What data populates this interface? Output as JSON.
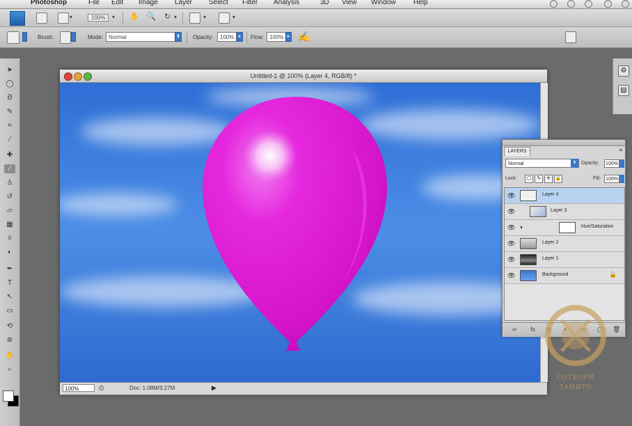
{
  "menu": {
    "app": "Photoshop",
    "items": [
      "File",
      "Edit",
      "Image",
      "Layer",
      "Select",
      "Filter",
      "Analysis",
      "3D",
      "View",
      "Window",
      "Help"
    ]
  },
  "appbar": {
    "zoom": "100%"
  },
  "options": {
    "brush_label": "Brush:",
    "mode_label": "Mode:",
    "mode_value": "Normal",
    "opacity_label": "Opacity:",
    "opacity_value": "100%",
    "flow_label": "Flow:",
    "flow_value": "100%"
  },
  "document": {
    "title": "Untitled-1 @ 100% (Layer 4, RGB/8) *",
    "zoom": "100%",
    "doc_info": "Doc: 1.08M/3.27M"
  },
  "layers_panel": {
    "tab": "LAYERS",
    "blend_mode": "Normal",
    "opacity_label": "Opacity:",
    "opacity_value": "100%",
    "fill_label": "Fill:",
    "fill_value": "100%",
    "lock_label": "Lock:",
    "layers": [
      {
        "name": "Layer 4",
        "selected": true
      },
      {
        "name": "Layer 3",
        "selected": false
      },
      {
        "name": "Hue/Saturation",
        "selected": false
      },
      {
        "name": "Layer 2",
        "selected": false
      },
      {
        "name": "Layer 1",
        "selected": false
      },
      {
        "name": "Background",
        "selected": false
      }
    ]
  },
  "watermark": {
    "line1": "СОТВОРИ",
    "line2": "ЗАНЯТО"
  },
  "colors": {
    "balloon": "#e21ad6",
    "sky": "#3a78d8",
    "selection": "#b7d3f0",
    "accent": "#3b78c9"
  },
  "icons": {
    "tools": [
      "move-icon",
      "marquee-icon",
      "lasso-icon",
      "quick-select-icon",
      "crop-icon",
      "eyedropper-icon",
      "healing-icon",
      "brush-icon",
      "stamp-icon",
      "history-brush-icon",
      "eraser-icon",
      "gradient-icon",
      "blur-icon",
      "dodge-icon",
      "pen-icon",
      "type-icon",
      "path-select-icon",
      "shape-icon",
      "3d-rotate-icon",
      "3d-orbit-icon",
      "hand-icon",
      "zoom-icon"
    ]
  }
}
